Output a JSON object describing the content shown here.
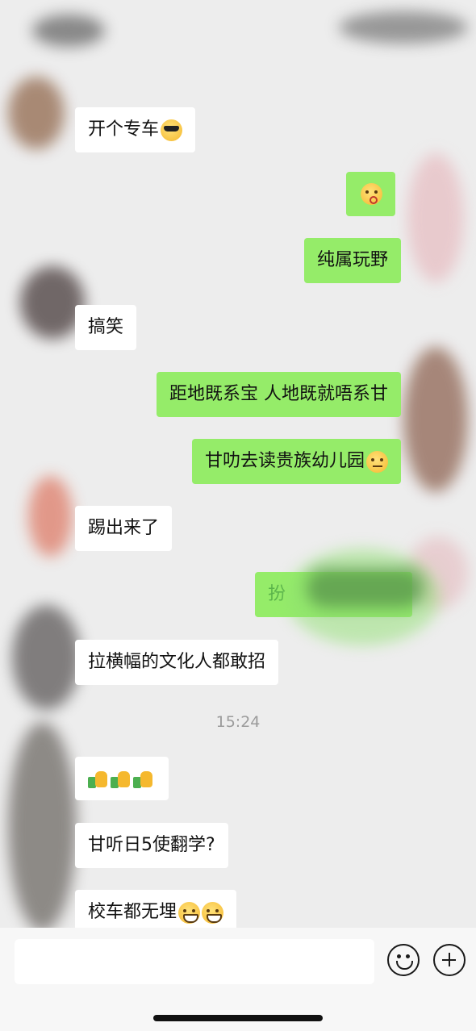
{
  "messages": [
    {
      "side": "left",
      "text": "开个专车",
      "emoji": "cool"
    },
    {
      "side": "right",
      "text": "",
      "emoji": "kiss"
    },
    {
      "side": "right",
      "text": "纯属玩野"
    },
    {
      "side": "left",
      "text": "搞笑"
    },
    {
      "side": "right",
      "text": "距地既系宝 人地既就唔系甘"
    },
    {
      "side": "right",
      "text": "甘叻去读贵族幼儿园",
      "emoji": "roll"
    },
    {
      "side": "left",
      "text": "踢出来了"
    },
    {
      "side": "right",
      "text": "扮",
      "redacted": true
    },
    {
      "side": "left",
      "text": "拉横幅的文化人都敢招"
    },
    {
      "side": "left",
      "text": "",
      "thumbs": 3
    },
    {
      "side": "left",
      "text": "甘听日5使翻学?"
    },
    {
      "side": "left",
      "text": "校车都无埋",
      "emoji": "grin",
      "emoji_count": 2
    }
  ],
  "timestamp": "15:24",
  "input": {
    "value": ""
  },
  "icons": {
    "emoji_button": "smiley-icon",
    "more_button": "plus-circle-icon"
  }
}
